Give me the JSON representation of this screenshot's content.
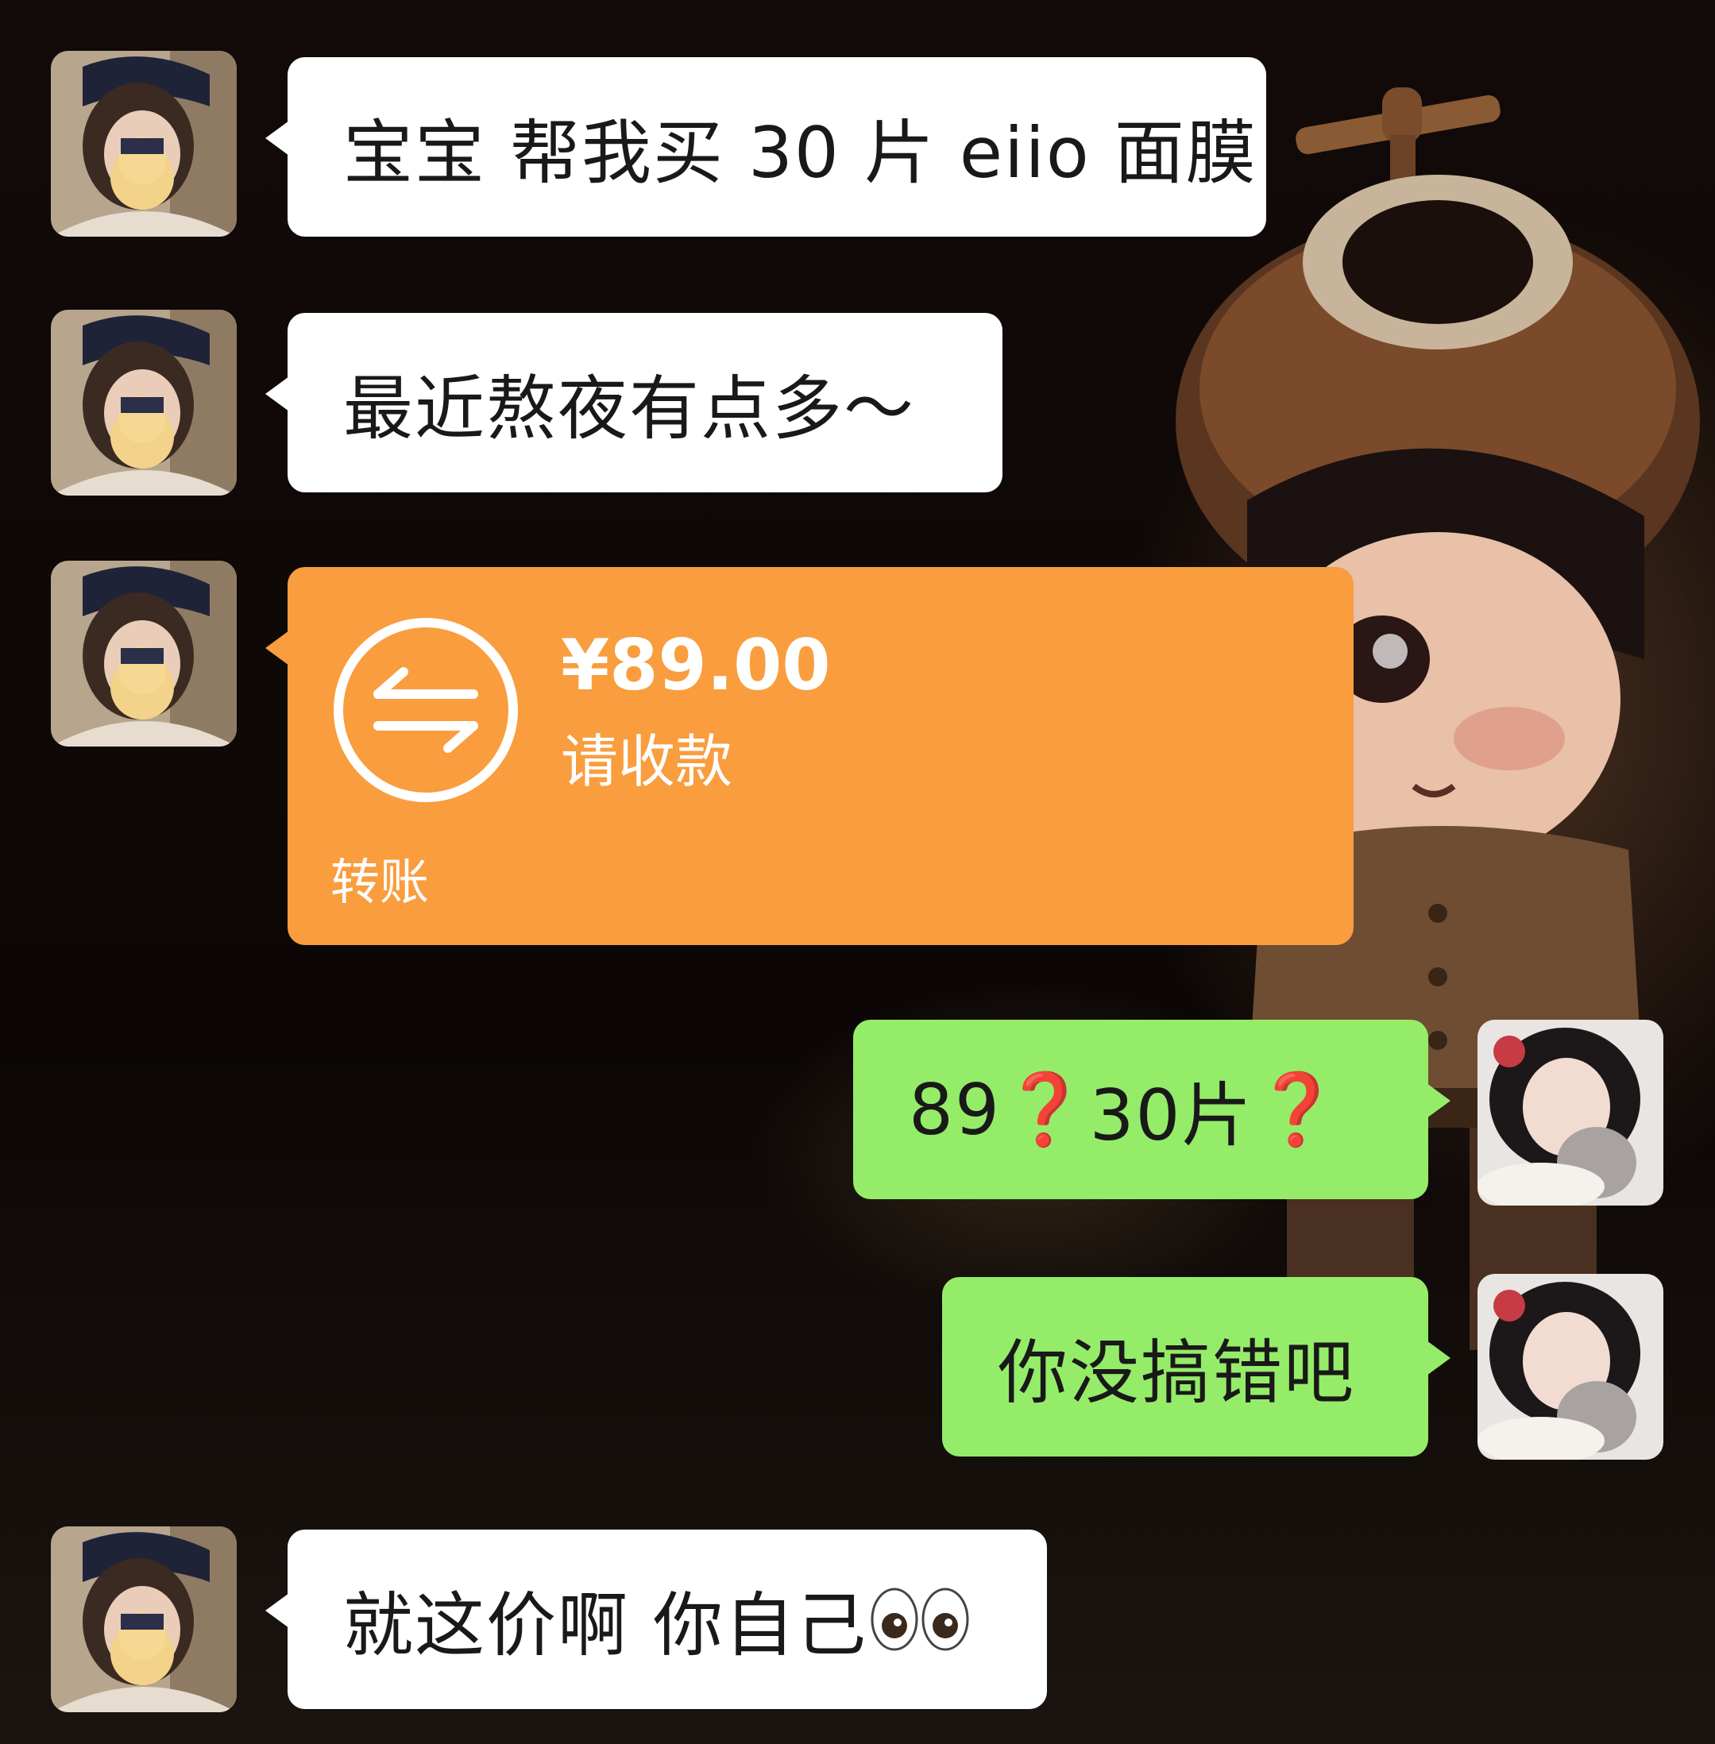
{
  "messages": [
    {
      "sender": "other",
      "text": "宝宝 帮我买 30 片 eiio 面膜"
    },
    {
      "sender": "other",
      "text": "最近熬夜有点多～"
    },
    {
      "sender": "other",
      "type": "transfer",
      "amount": "¥89.00",
      "note": "请收款",
      "label": "转账"
    },
    {
      "sender": "me",
      "parts": [
        "89",
        "❓",
        "30片",
        "❓"
      ]
    },
    {
      "sender": "me",
      "text": "你没搞错吧"
    },
    {
      "sender": "other",
      "text": "就这价啊 你自己",
      "emoji": "eyes-emoji"
    }
  ],
  "colors": {
    "white_bubble": "#ffffff",
    "green_bubble": "#95ec69",
    "transfer_card": "#f99d3e",
    "question_mark": "#e0141b"
  }
}
